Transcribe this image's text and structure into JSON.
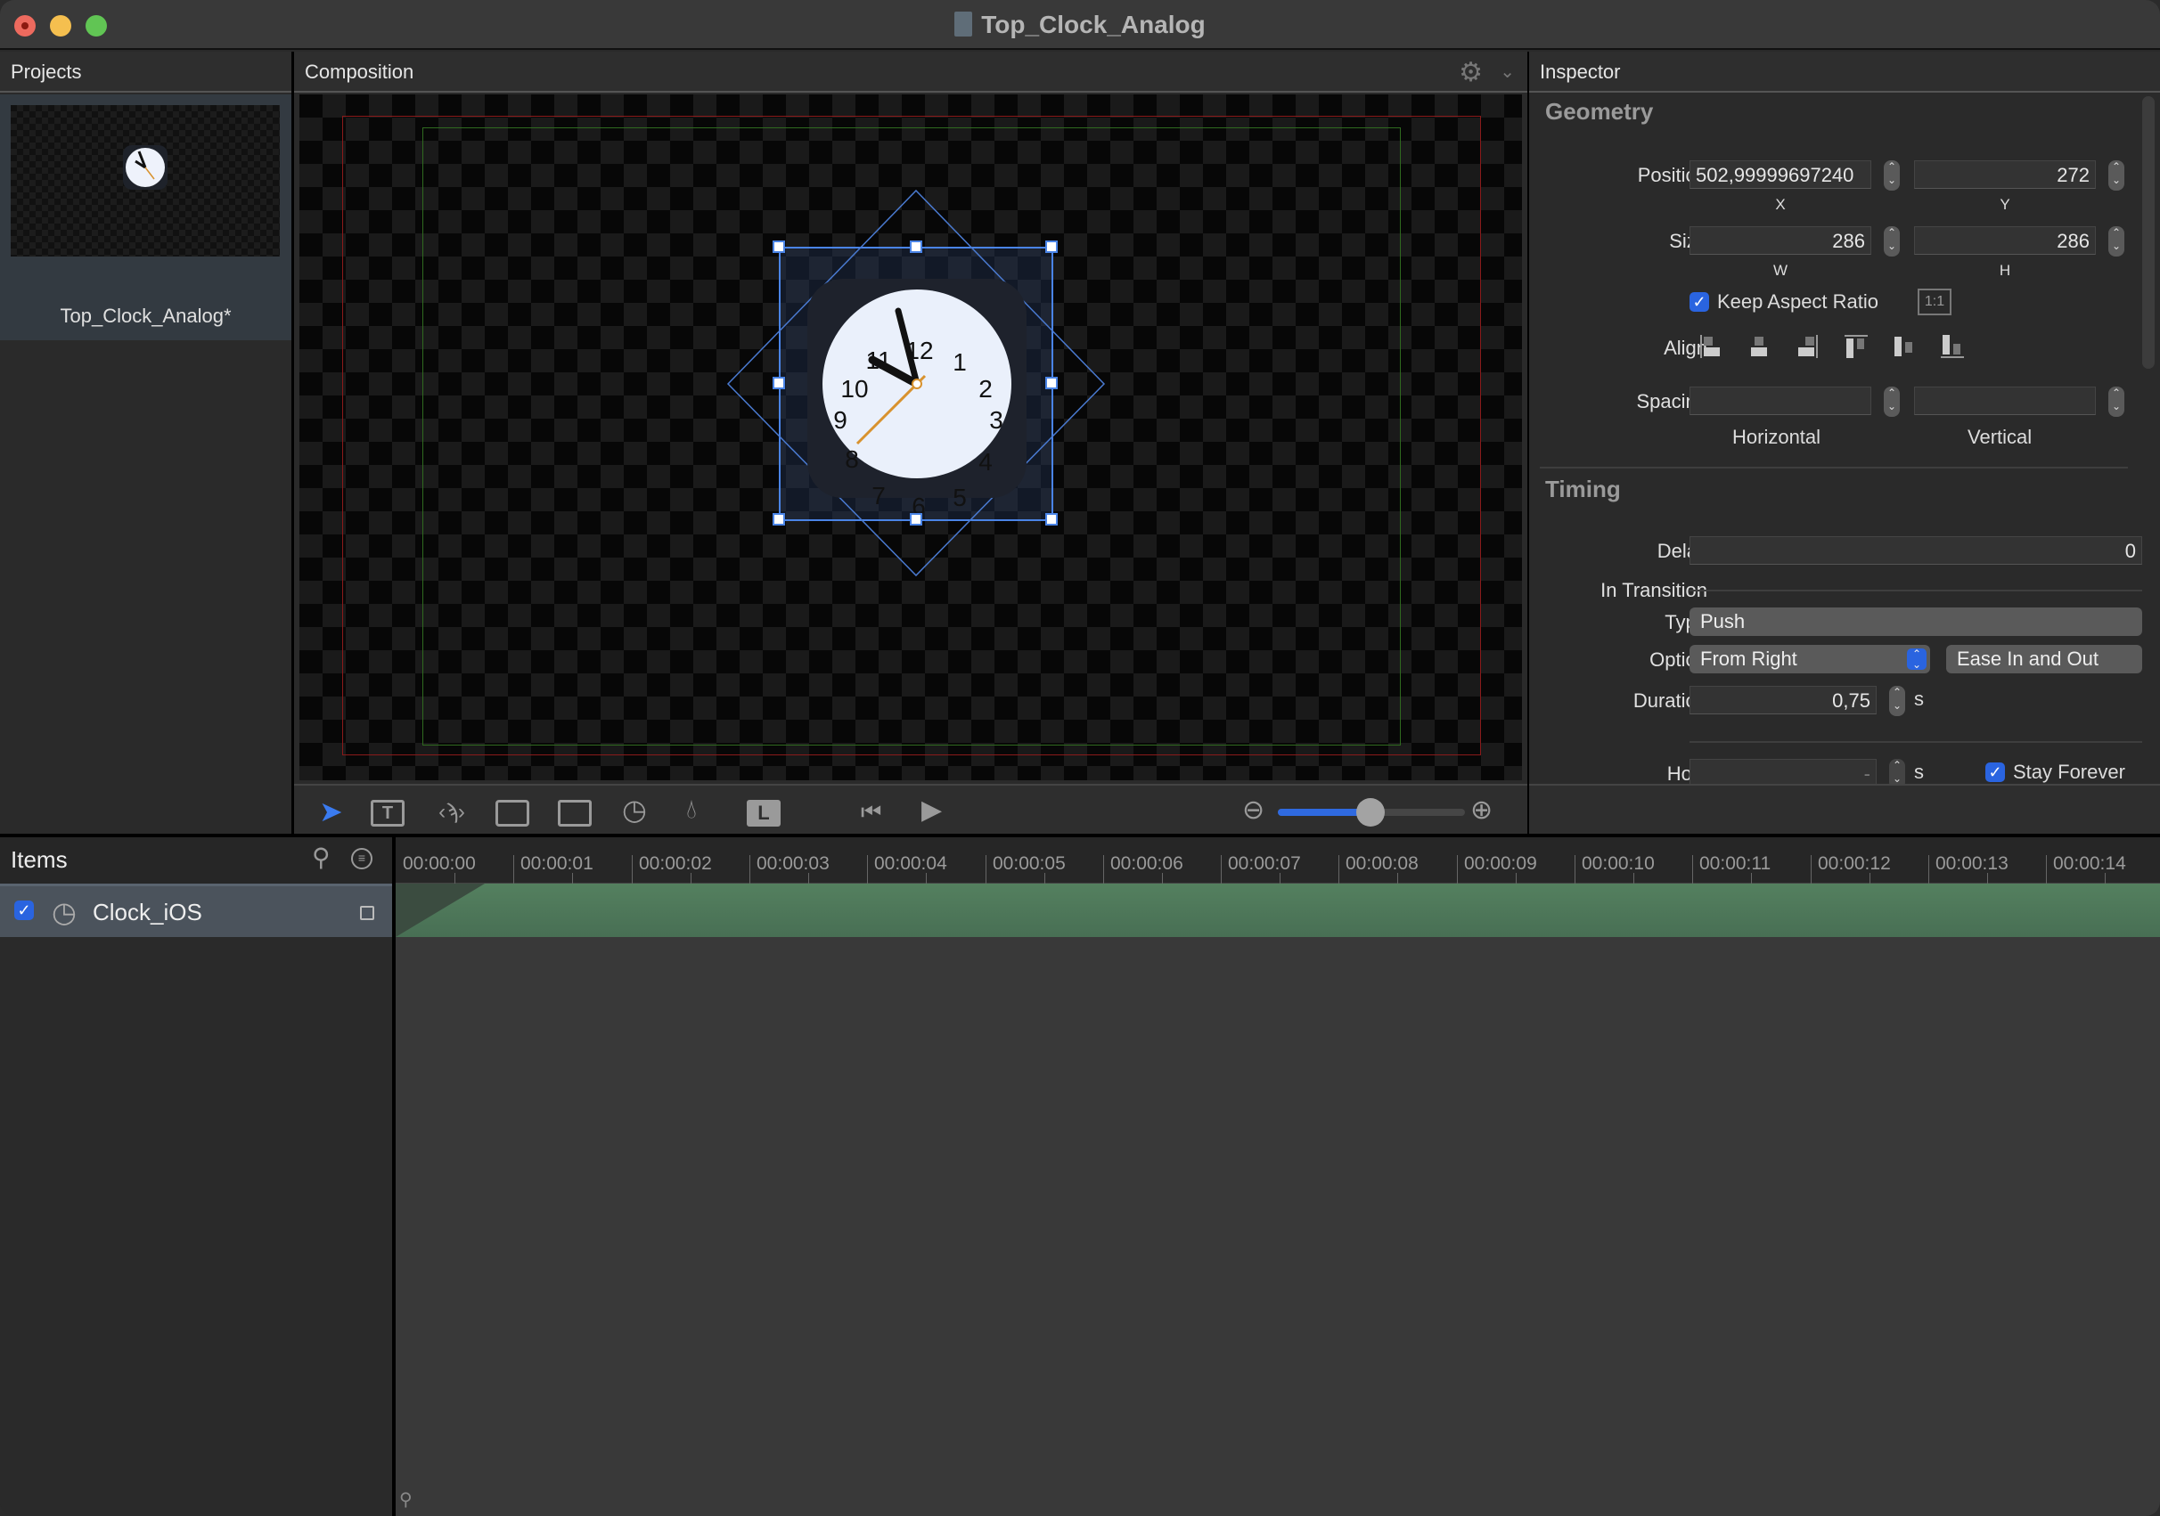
{
  "window": {
    "title": "Top_Clock_Analog"
  },
  "projects": {
    "header": "Projects",
    "items": [
      {
        "name": "Top_Clock_Analog*"
      }
    ],
    "add_label": "+",
    "remove_label": "−"
  },
  "composition": {
    "header": "Composition",
    "zoom_level": 0.5
  },
  "inspector": {
    "header": "Inspector",
    "geometry": {
      "title": "Geometry",
      "position_label": "Position",
      "x": "502,99999697240",
      "y": "272",
      "x_label": "X",
      "y_label": "Y",
      "size_label": "Size",
      "w": "286",
      "h": "286",
      "w_label": "W",
      "h_label": "H",
      "keep_aspect_label": "Keep Aspect Ratio",
      "keep_aspect": true,
      "ratio_button": "1:1",
      "align_label": "Align",
      "spacing_label": "Spacing",
      "spacing_h": "",
      "spacing_v": "",
      "horizontal_label": "Horizontal",
      "vertical_label": "Vertical"
    },
    "timing": {
      "title": "Timing",
      "delay_label": "Delay",
      "delay": "0",
      "in_transition_label": "In Transition",
      "type_label": "Type",
      "type": "Push",
      "option_label": "Option",
      "option": "From Right",
      "easing": "Ease In and Out",
      "duration_label": "Duration",
      "duration": "0,75",
      "unit": "s",
      "hold_label": "Hold",
      "hold": "-",
      "stay_forever_label": "Stay Forever",
      "stay_forever": true
    }
  },
  "items": {
    "header": "Items",
    "rows": [
      {
        "name": "Clock_iOS",
        "checked": true
      }
    ]
  },
  "timeline": {
    "ticks": [
      "00:00:00",
      "00:00:01",
      "00:00:02",
      "00:00:03",
      "00:00:04",
      "00:00:05",
      "00:00:06",
      "00:00:07",
      "00:00:08",
      "00:00:09",
      "00:00:10",
      "00:00:11",
      "00:00:12",
      "00:00:13",
      "00:00:14"
    ]
  },
  "colors": {
    "accent": "#2a64e0",
    "track": "#4f7a5a"
  }
}
